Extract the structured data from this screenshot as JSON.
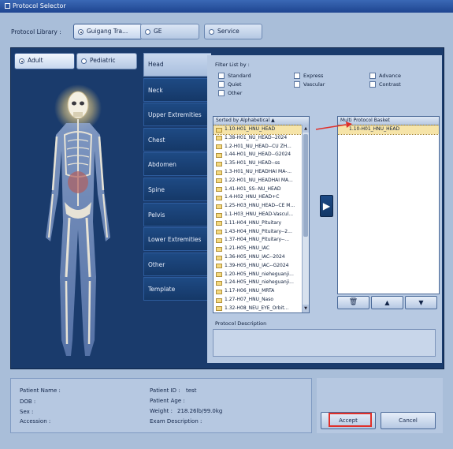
{
  "window_title": "Protocol Selector",
  "protocol_library": {
    "label": "Protocol Library :",
    "options": [
      "Guigang Tra...",
      "GE",
      "Service"
    ],
    "selected": "Guigang Tra..."
  },
  "patient_type": {
    "options": [
      "Adult",
      "Pediatric"
    ],
    "selected": "Adult"
  },
  "body_tabs": [
    "Head",
    "Neck",
    "Upper Extremities",
    "Chest",
    "Abdomen",
    "Spine",
    "Pelvis",
    "Lower Extremities",
    "Other",
    "Template"
  ],
  "selected_tab": "Head",
  "filter": {
    "label": "Filter List by :",
    "options": [
      "Standard",
      "Express",
      "Advance",
      "Quiet",
      "Vascular",
      "Contrast",
      "Other"
    ]
  },
  "protocol_list": {
    "header": "Sorted by Alphabetical ▲",
    "items": [
      "1.10-H01_HNU_HEAD",
      "1.38-H01_NU_HEAD--2024",
      "1.2-H01_NU_HEAD--CU ZH...",
      "1.44-H01_NU_HEAD--G2024",
      "1.35-H01_NU_HEAD--ss",
      "1.3-H01_NU_HEADHAI MA-...",
      "1.22-H01_NU_HEADHAI MA...",
      "1.41-H01_SS--NU_HEAD",
      "1.4-H02_HNU_HEAD+C",
      "1.25-H03_HNU_HEAD--CE M...",
      "1.1-H03_HNU_HEAD-Vascul...",
      "1.11-H04_HNU_Pituitary",
      "1.43-H04_HNU_Pituitary--2...",
      "1.37-H04_HNU_Pituitary--...",
      "1.21-H05_HNU_IAC",
      "1.36-H05_HNU_IAC--2024",
      "1.39-H05_HNU_IAC--G2024",
      "1.20-H05_HNU_nieheguanji...",
      "1.24-H05_HNU_nieheguanji...",
      "1.17-H06_HNU_MRTA",
      "1.27-H07_HNU_Naso",
      "1.32-H08_NEU_EYE_Orbit..."
    ],
    "selected_index": 0
  },
  "basket": {
    "header": "Multi Protocol Basket",
    "items": [
      "1.10-H01_HNU_HEAD"
    ]
  },
  "protocol_description": {
    "label": "Protocol Description",
    "text": ""
  },
  "patient": {
    "name_label": "Patient Name :",
    "dob_label": "DOB :",
    "sex_label": "Sex :",
    "accession_label": "Accession :",
    "id_label": "Patient ID :",
    "id_value": "test",
    "age_label": "Patient Age :",
    "weight_label": "Weight :",
    "weight_value": "218.26lb/99.0kg",
    "exam_label": "Exam Description :"
  },
  "buttons": {
    "accept": "Accept",
    "cancel": "Cancel"
  },
  "colors": {
    "highlight_red": "#e0302a",
    "panel_dark": "#1a3b6c",
    "bg": "#a9bed9"
  }
}
